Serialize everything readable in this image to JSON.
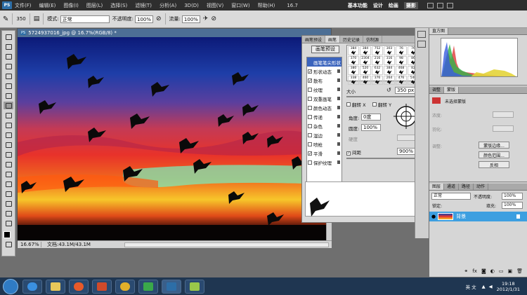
{
  "menubar": {
    "logo": "PS",
    "items": [
      "文件(F)",
      "编辑(E)",
      "图像(I)",
      "图层(L)",
      "选择(S)",
      "滤镜(T)",
      "分析(A)",
      "3D(D)",
      "视图(V)",
      "窗口(W)",
      "帮助(H)"
    ],
    "zoom": "16.7",
    "workspaces": [
      "基本功能",
      "设计",
      "绘画",
      "摄影"
    ]
  },
  "options": {
    "brush_size": "350",
    "mode_label": "模式:",
    "mode_value": "正常",
    "opacity_label": "不透明度:",
    "opacity_value": "100%",
    "flow_label": "流量:",
    "flow_value": "100%"
  },
  "document": {
    "title": "5724937016_jpg @ 16.7%(RGB/8) *",
    "zoom": "16.67%",
    "doc_info": "文档:43.1M/43.1M"
  },
  "brush_panel": {
    "tabs": [
      "画笔预设",
      "画笔",
      "历史记录",
      "仿制源"
    ],
    "preset_button": "画笔预设",
    "options": [
      {
        "label": "画笔笔尖形状",
        "checked": false
      },
      {
        "label": "形状动态",
        "checked": true
      },
      {
        "label": "散布",
        "checked": true
      },
      {
        "label": "纹理",
        "checked": false
      },
      {
        "label": "双重画笔",
        "checked": false
      },
      {
        "label": "颜色动态",
        "checked": false
      },
      {
        "label": "传递",
        "checked": false
      },
      {
        "label": "杂色",
        "checked": false
      },
      {
        "label": "湿边",
        "checked": false
      },
      {
        "label": "喷枪",
        "checked": false
      },
      {
        "label": "平滑",
        "checked": true
      },
      {
        "label": "保护纹理",
        "checked": false
      }
    ],
    "tips": [
      "384",
      "384",
      "752",
      "303",
      "76",
      "76",
      "370",
      "2304",
      "216",
      "316",
      "98",
      "86",
      "380",
      "520",
      "632",
      "384",
      "468",
      "82",
      "338",
      "460",
      "376",
      "264",
      "476",
      "540"
    ],
    "size_label": "大小",
    "size_value": "350 px",
    "flip_x": "翻转 X",
    "flip_y": "翻转 Y",
    "angle_label": "角度:",
    "angle_value": "0度",
    "roundness_label": "圆度:",
    "roundness_value": "100%",
    "hardness_label": "硬度",
    "spacing_label": "间距",
    "spacing_value": "900%"
  },
  "histogram": {
    "tabs": [
      "直方图"
    ]
  },
  "adjustments": {
    "tabs": [
      "调整",
      "蒙版"
    ],
    "mask_name": "未选择蒙版",
    "density_label": "浓度:",
    "feather_label": "羽化:",
    "refine_label": "调整:",
    "buttons": [
      "蒙版边缘...",
      "颜色范围...",
      "反相"
    ]
  },
  "layers": {
    "tabs": [
      "图层",
      "通道",
      "路径",
      "动作"
    ],
    "blend_mode": "正常",
    "opacity_label": "不透明度:",
    "opacity_value": "100%",
    "lock_label": "锁定:",
    "fill_label": "填充:",
    "fill_value": "100%",
    "layer_name": "背景"
  },
  "taskbar": {
    "tray_text": "英 文",
    "time": "19:18",
    "date": "2012/1/31"
  },
  "colors": {
    "accent": "#3b64bd",
    "layer_selected": "#3d9fe0",
    "taskbar": "#1f3651"
  }
}
